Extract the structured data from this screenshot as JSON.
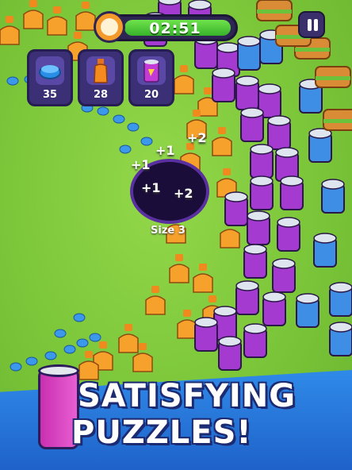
{
  "hud": {
    "timer": "02:51",
    "pause_icon": "pause-icon",
    "clock_icon": "stopwatch-icon"
  },
  "goals": [
    {
      "icon": "bottle-cap-icon",
      "count": "35",
      "color": "#2a8ee6"
    },
    {
      "icon": "juice-bottle-icon",
      "count": "28",
      "color": "#f58a1f"
    },
    {
      "icon": "soda-can-icon",
      "count": "20",
      "color": "#c33ad6"
    }
  ],
  "hole": {
    "size_label": "Size 3"
  },
  "score_popups": [
    "+1",
    "+1",
    "+2",
    "+1",
    "+2"
  ],
  "promo": {
    "line1": "SATISFYING",
    "line2": "PUZZLES!"
  },
  "colors": {
    "grass": "#7cc63a",
    "can": "#a43ad0",
    "blue_can": "#3f8ee6",
    "bottle": "#f4a52a",
    "banner": "#2876dc"
  }
}
